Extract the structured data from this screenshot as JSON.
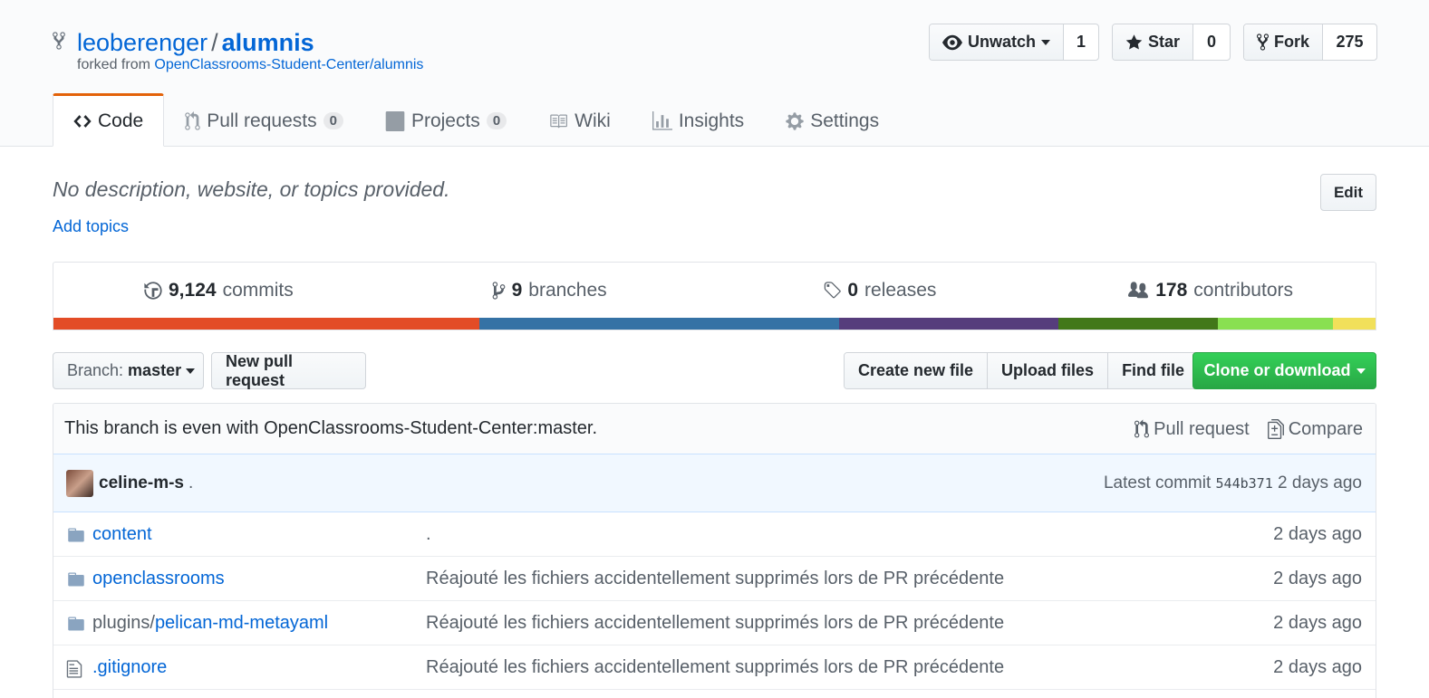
{
  "repo": {
    "owner": "leoberenger",
    "separator": "/",
    "name": "alumnis",
    "forked_prefix": "forked from",
    "forked_from": "OpenClassrooms-Student-Center/alumnis"
  },
  "actions": {
    "watch_label": "Unwatch",
    "watch_count": "1",
    "star_label": "Star",
    "star_count": "0",
    "fork_label": "Fork",
    "fork_count": "275"
  },
  "tabs": [
    {
      "label": "Code",
      "icon": "code-icon"
    },
    {
      "label": "Pull requests",
      "count": "0",
      "icon": "pull-request-icon"
    },
    {
      "label": "Projects",
      "count": "0",
      "icon": "project-icon"
    },
    {
      "label": "Wiki",
      "icon": "book-icon"
    },
    {
      "label": "Insights",
      "icon": "graph-icon"
    },
    {
      "label": "Settings",
      "icon": "gear-icon"
    }
  ],
  "about": {
    "description": "No description, website, or topics provided.",
    "add_topics": "Add topics",
    "edit_label": "Edit"
  },
  "summary": {
    "commits_num": "9,124",
    "commits_label": "commits",
    "branches_num": "9",
    "branches_label": "branches",
    "releases_num": "0",
    "releases_label": "releases",
    "contributors_num": "178",
    "contributors_label": "contributors"
  },
  "language_bar": [
    {
      "color": "#e34c26",
      "fraction": 0.322
    },
    {
      "color": "#3572a5",
      "fraction": 0.272
    },
    {
      "color": "#563d7c",
      "fraction": 0.166
    },
    {
      "color": "#427819",
      "fraction": 0.121
    },
    {
      "color": "#89e051",
      "fraction": 0.087
    },
    {
      "color": "#f1e05a",
      "fraction": 0.032
    }
  ],
  "toolbar": {
    "branch_prefix": "Branch:",
    "branch_name": "master",
    "new_pr": "New pull request",
    "create_file": "Create new file",
    "upload_files": "Upload files",
    "find_file": "Find file",
    "clone": "Clone or download"
  },
  "branch_status": {
    "text": "This branch is even with OpenClassrooms-Student-Center:master.",
    "pull_request": "Pull request",
    "compare": "Compare"
  },
  "latest_commit": {
    "author": "celine-m-s",
    "message": ".",
    "prefix": "Latest commit",
    "sha": "544b371",
    "age": "2 days ago"
  },
  "files": [
    {
      "type": "folder",
      "prefix": "",
      "name": "content",
      "message": ".",
      "age": "2 days ago"
    },
    {
      "type": "folder",
      "prefix": "",
      "name": "openclassrooms",
      "message": "Réajouté les fichiers accidentellement supprimés lors de PR précédente",
      "age": "2 days ago"
    },
    {
      "type": "folder",
      "prefix": "plugins/",
      "name": "pelican-md-metayaml",
      "message": "Réajouté les fichiers accidentellement supprimés lors de PR précédente",
      "age": "2 days ago"
    },
    {
      "type": "file",
      "prefix": "",
      "name": ".gitignore",
      "message": "Réajouté les fichiers accidentellement supprimés lors de PR précédente",
      "age": "2 days ago"
    }
  ]
}
